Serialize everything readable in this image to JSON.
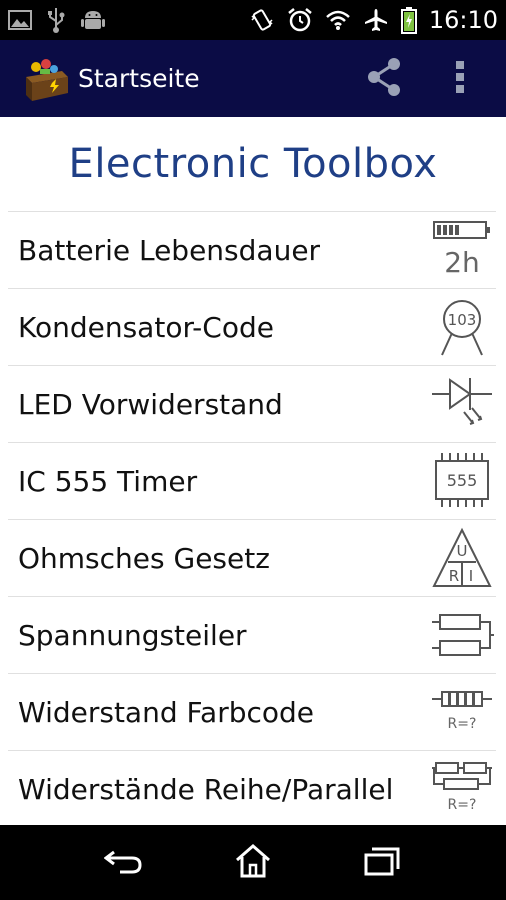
{
  "status_bar": {
    "time": "16:10",
    "left_icons": [
      "image-icon",
      "usb-icon",
      "android-icon"
    ],
    "right_icons": [
      "vibrate-icon",
      "alarm-icon",
      "wifi-icon",
      "airplane-icon",
      "battery-icon"
    ]
  },
  "action_bar": {
    "title": "Startseite",
    "background": "#0b0c45",
    "icons": [
      "toolbox-icon",
      "share-icon",
      "overflow-menu-icon"
    ]
  },
  "main": {
    "heading": "Electronic Toolbox",
    "heading_color": "#1f3f86",
    "tools": [
      {
        "label": "Batterie Lebensdauer",
        "icon": "battery-life-icon",
        "icon_text": "2h"
      },
      {
        "label": "Kondensator-Code",
        "icon": "capacitor-icon",
        "icon_text": "103"
      },
      {
        "label": "LED Vorwiderstand",
        "icon": "led-icon"
      },
      {
        "label": "IC 555 Timer",
        "icon": "ic-chip-icon",
        "icon_text": "555"
      },
      {
        "label": "Ohmsches Gesetz",
        "icon": "ohms-law-triangle-icon",
        "icon_text": [
          "U",
          "R",
          "I"
        ]
      },
      {
        "label": "Spannungsteiler",
        "icon": "voltage-divider-icon"
      },
      {
        "label": "Widerstand Farbcode",
        "icon": "resistor-color-icon",
        "icon_text": "R=?"
      },
      {
        "label": "Widerstände Reihe/Parallel",
        "icon": "resistor-network-icon",
        "icon_text": "R=?"
      }
    ]
  },
  "nav_bar": {
    "buttons": [
      "back-icon",
      "home-icon",
      "recent-apps-icon"
    ]
  }
}
